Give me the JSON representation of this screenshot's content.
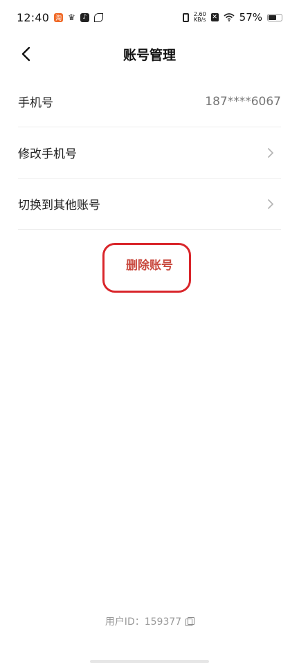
{
  "status_bar": {
    "time": "12:40",
    "net_speed_value": "2.60",
    "net_speed_unit": "KB/s",
    "battery_percent": "57%",
    "battery_level": 0.57,
    "app_icons": [
      "taobao-icon",
      "crown-icon",
      "tiktok-icon",
      "leaf-icon"
    ]
  },
  "header": {
    "back_icon": "chevron-left-icon",
    "title": "账号管理"
  },
  "list": {
    "rows": [
      {
        "label": "手机号",
        "value": "187****6067"
      },
      {
        "label": "修改手机号"
      },
      {
        "label": "切换到其他账号"
      }
    ]
  },
  "delete": {
    "label": "删除账号",
    "highlight_color": "#d9252a",
    "text_color": "#c94a3f"
  },
  "footer": {
    "user_id_label": "用户ID：",
    "user_id_value": "159377"
  }
}
